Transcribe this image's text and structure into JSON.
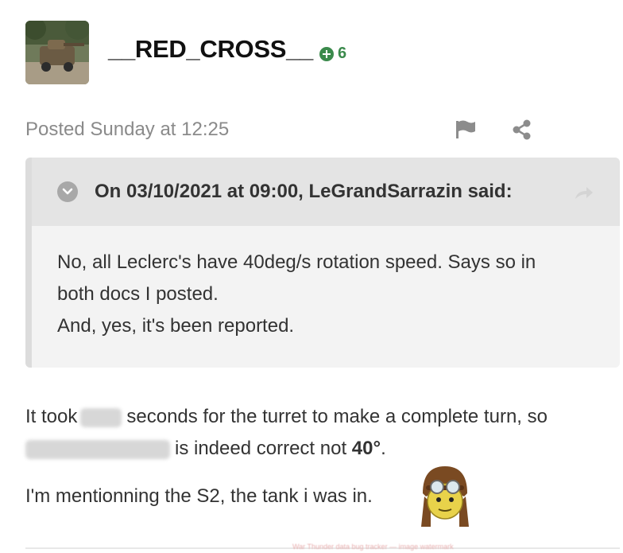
{
  "author": {
    "username": "__RED_CROSS__",
    "reputation": "6",
    "avatar_icon": "tank-avatar-image"
  },
  "post": {
    "posted_label": "Posted Sunday at 12:25",
    "icons": [
      "flag-icon",
      "share-icon"
    ]
  },
  "quote": {
    "citation": "On 03/10/2021 at 09:00, LeGrandSarrazin said:",
    "body_line1": "No, all Leclerc's have 40deg/s rotation speed. Says so in",
    "body_line2": "both docs I posted.",
    "body_line3": "And, yes, it's been reported."
  },
  "body": {
    "line1_prefix": "It took",
    "line1_suffix": "seconds for the turret to make a complete turn, so",
    "line2_suffix": "is indeed correct not",
    "line2_bold": "40°",
    "line2_end": ".",
    "line3": "I'm mentionning the S2, the tank i was in.",
    "emoji": "pilot-smiley-emoji"
  },
  "colors": {
    "reputation_green": "#3b8a4c",
    "quote_bg": "#f3f3f3",
    "quote_head_bg": "#e4e4e4",
    "muted_text": "#8a8a8a"
  }
}
